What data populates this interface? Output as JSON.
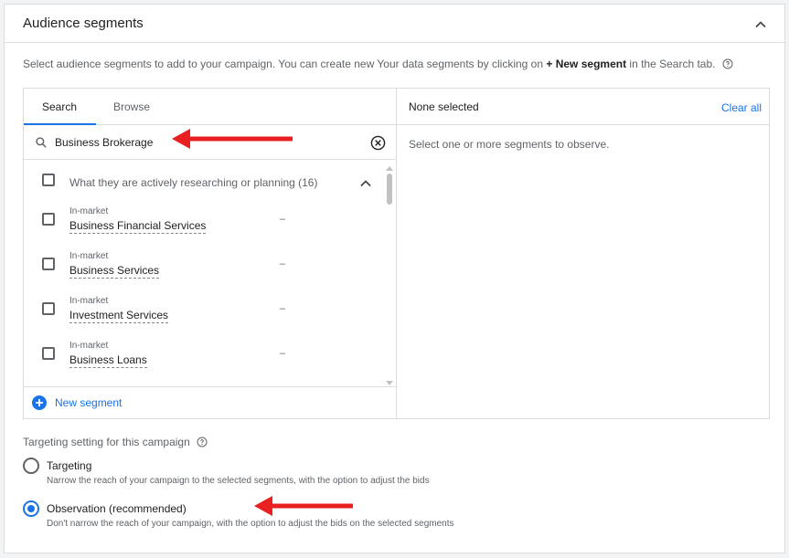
{
  "header": {
    "title": "Audience segments",
    "collapse_icon": "chevron-up-icon"
  },
  "description": {
    "before": "Select audience segments to add to your campaign. You can create new Your data segments by clicking on ",
    "emphasis": "+ New segment",
    "after": " in the Search tab."
  },
  "tabs": [
    {
      "label": "Search",
      "active": true
    },
    {
      "label": "Browse",
      "active": false
    }
  ],
  "search": {
    "value": "Business Brokerage",
    "placeholder": ""
  },
  "group": {
    "label": "What they are actively researching or planning (16)",
    "checked": false,
    "expanded": true
  },
  "items": [
    {
      "category": "In-market",
      "name": "Business Financial Services",
      "metric": "–"
    },
    {
      "category": "In-market",
      "name": "Business Services",
      "metric": "–"
    },
    {
      "category": "In-market",
      "name": "Investment Services",
      "metric": "–"
    },
    {
      "category": "In-market",
      "name": "Business Loans",
      "metric": "–"
    }
  ],
  "new_segment": {
    "label": "New segment"
  },
  "selected": {
    "title": "None selected",
    "clear_all": "Clear all",
    "hint": "Select one or more segments to observe."
  },
  "targeting": {
    "title": "Targeting setting for this campaign",
    "options": [
      {
        "label": "Targeting",
        "description": "Narrow the reach of your campaign to the selected segments, with the option to adjust the bids",
        "checked": false
      },
      {
        "label": "Observation (recommended)",
        "description": "Don't narrow the reach of your campaign, with the option to adjust the bids on the selected segments",
        "checked": true
      }
    ]
  },
  "colors": {
    "accent": "#1a73e8",
    "annotation_arrow": "#e8201f"
  }
}
